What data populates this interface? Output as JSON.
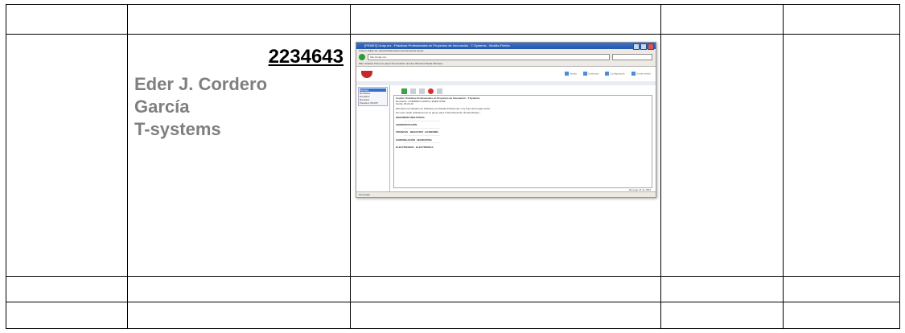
{
  "record": {
    "id_number": "2234643",
    "name_line1": "Eder J. Cordero",
    "name_line2": "García",
    "company": "T-systems"
  },
  "screenshot": {
    "description_hidden": false,
    "window_title": "[PEMEX] Unap.mx - Prácticas Profesionales en Proyectos de Innovación - T-Systems - Mozilla Firefox",
    "menu": "Archivo  Editar  Ver  Historial  Marcadores  Herramientas  Ayuda",
    "url": "http://unap.mx/...",
    "bookmarks": "Más visitados  Primeros pasos  Personalizar vínculos  Windows Media  Windows",
    "head_links": [
      "Ayuda",
      "Contenido",
      "Configuración",
      "Cerrar sesión"
    ],
    "sidebar": [
      "Bandeja",
      "Recibidos",
      "Enviados",
      "Borrados",
      "Papelera (15437)"
    ],
    "message_header": "Asunto: Prácticas Profesionales en Proyectos de Innovación - T-Systems",
    "message_lines": [
      "Remitente: CORDERO GARCIA, EDER JOSE",
      "Fecha: 06-04-10",
      "Estimado Coordinador de Prácticas y/o Estadía Profesional, muy buen día tengan todos:",
      "Por este medio solicitamos de su apoyo para el Reclutamiento de Estudiantes..."
    ],
    "bullets": [
      "INGENIERÍA INDUSTRIAL",
      "ADMINISTRACIÓN",
      "FINANZAS - NEGOCIOS - ECONOMÍA",
      "COMUNICACIÓN - MARKETING",
      "ELECTRICIDAD - ELECTRÓNICA"
    ],
    "pager": "Mensaje 18 de 1894",
    "status": "Terminado"
  }
}
